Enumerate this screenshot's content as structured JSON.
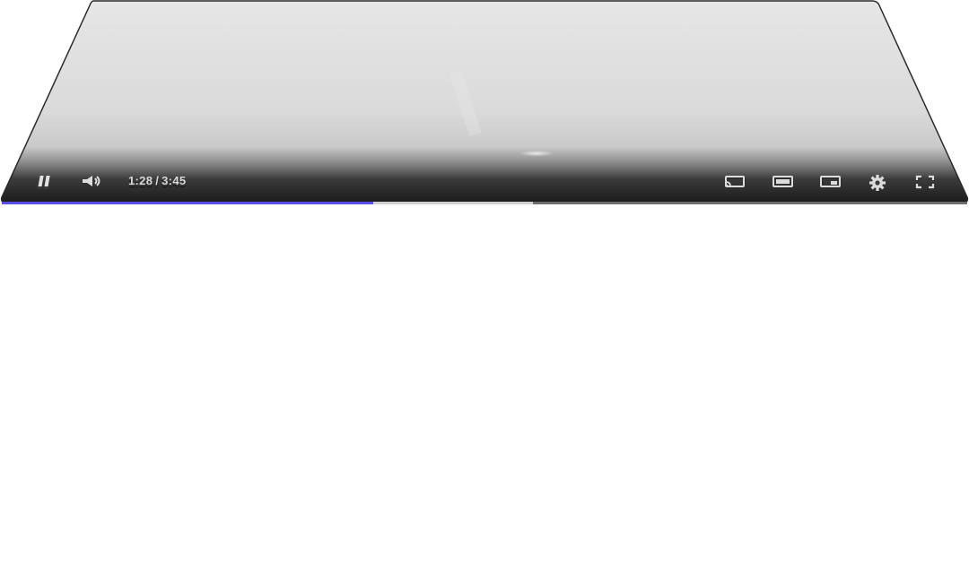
{
  "player": {
    "time": {
      "current": "1:28",
      "separator": "/",
      "duration": "3:45"
    },
    "progress": {
      "played_fraction": 0.385,
      "buffered_fraction": 0.55
    },
    "colors": {
      "accent": "#5b4ee6",
      "buffer": "#cfcfcf",
      "track": "#6d6d6d",
      "bar_dark": "#1c1c1c",
      "video_bg": "#d8d8d8"
    },
    "controls_left": [
      {
        "name": "pause-button",
        "icon": "pause-icon"
      },
      {
        "name": "volume-button",
        "icon": "volume-icon"
      }
    ],
    "controls_right": [
      {
        "name": "cast-button",
        "icon": "cast-icon"
      },
      {
        "name": "theater-mode-button",
        "icon": "theater-icon"
      },
      {
        "name": "miniplayer-button",
        "icon": "miniplayer-icon"
      },
      {
        "name": "settings-button",
        "icon": "gear-icon"
      },
      {
        "name": "fullscreen-button",
        "icon": "fullscreen-icon"
      }
    ]
  }
}
